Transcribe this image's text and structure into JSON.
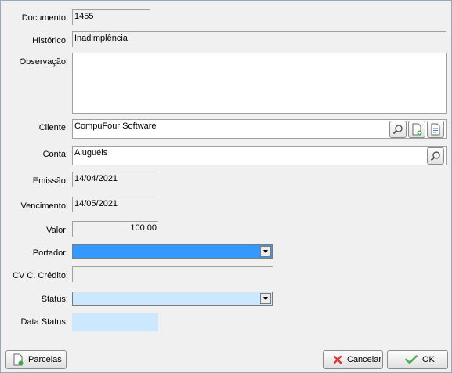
{
  "labels": {
    "documento": "Documento:",
    "historico": "Histórico:",
    "observacao": "Observação:",
    "cliente": "Cliente:",
    "conta": "Conta:",
    "emissao": "Emissão:",
    "vencimento": "Vencimento:",
    "valor": "Valor:",
    "portador": "Portador:",
    "cv_credito": "CV C. Crédito:",
    "status": "Status:",
    "data_status": "Data Status:"
  },
  "values": {
    "documento": "1455",
    "historico": "Inadimplência",
    "observacao": "",
    "cliente": "CompuFour Software",
    "conta": "Aluguéis",
    "emissao": "14/04/2021",
    "vencimento": "14/05/2021",
    "valor": "100,00",
    "portador": "",
    "cv_credito": "",
    "status": "",
    "data_status": ""
  },
  "buttons": {
    "parcelas": "Parcelas",
    "cancelar": "Cancelar",
    "ok": "OK"
  },
  "icons": {
    "cliente_search": "magnifier-icon",
    "cliente_new": "new-document-icon",
    "cliente_edit": "document-icon",
    "conta_search": "magnifier-icon",
    "parcelas": "document-icon",
    "cancelar": "red-x-icon",
    "ok": "green-check-icon"
  },
  "colors": {
    "portador_selected": "#3399ff",
    "status_bg": "#cce8ff",
    "data_status_bg": "#cce8ff",
    "cancel_icon": "#e0383a",
    "ok_icon": "#4caf50"
  }
}
